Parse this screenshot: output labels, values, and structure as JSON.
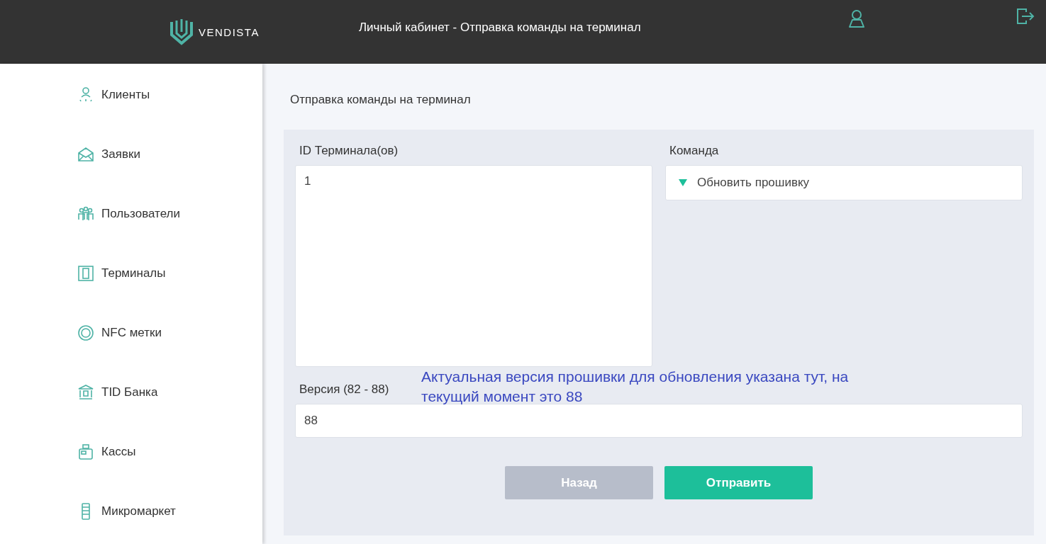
{
  "header": {
    "logo": "VENDISTA",
    "title": "Личный кабинет - Отправка команды на терминал"
  },
  "sidebar": {
    "items": [
      {
        "label": "Клиенты"
      },
      {
        "label": "Заявки"
      },
      {
        "label": "Пользователи"
      },
      {
        "label": "Терминалы"
      },
      {
        "label": "NFC метки"
      },
      {
        "label": "TID Банка"
      },
      {
        "label": "Кассы"
      },
      {
        "label": "Микромаркет"
      }
    ]
  },
  "page_title": "Отправка команды на терминал",
  "form": {
    "terminal_ids": {
      "label": "ID Терминала(ов)",
      "value": "1"
    },
    "command": {
      "label": "Команда",
      "value": "Обновить прошивку"
    },
    "version": {
      "label": "Версия (82 - 88)",
      "value": "88"
    },
    "annotation": "Актуальная версия прошивки для обновления указана тут, на текущий момент это 88",
    "buttons": [
      {
        "label": "Назад",
        "kind": "secondary"
      },
      {
        "label": "Отправить",
        "kind": "primary"
      }
    ]
  }
}
